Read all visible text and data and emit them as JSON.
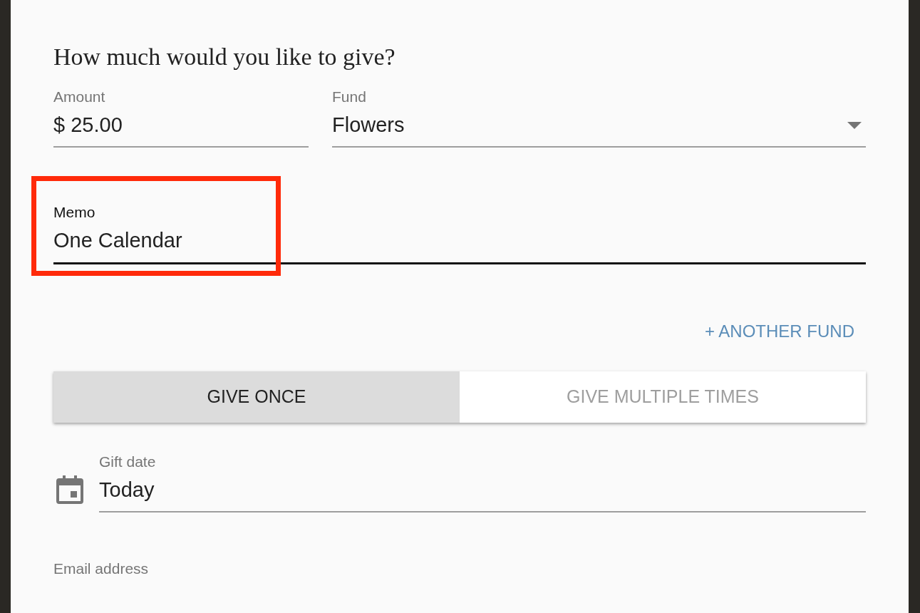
{
  "heading": "How much would you like to give?",
  "amount": {
    "label": "Amount",
    "value": "$ 25.00"
  },
  "fund": {
    "label": "Fund",
    "value": "Flowers"
  },
  "memo": {
    "label": "Memo",
    "value": "One Calendar",
    "focused": true,
    "highlighted": true
  },
  "another_fund": "+ ANOTHER FUND",
  "frequency_tabs": [
    {
      "label": "GIVE ONCE",
      "selected": true
    },
    {
      "label": "GIVE MULTIPLE TIMES",
      "selected": false
    }
  ],
  "gift_date": {
    "label": "Gift date",
    "value": "Today"
  },
  "email": {
    "label": "Email address"
  }
}
